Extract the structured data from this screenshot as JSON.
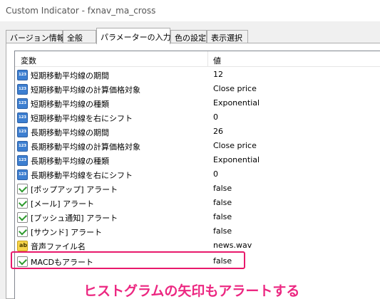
{
  "window": {
    "title": "Custom Indicator - fxnav_ma_cross"
  },
  "tabs": [
    {
      "label": "バージョン情報"
    },
    {
      "label": "全般"
    },
    {
      "label": "パラメーターの入力",
      "active": true
    },
    {
      "label": "色の設定"
    },
    {
      "label": "表示選択"
    }
  ],
  "grid": {
    "header_variable": "変数",
    "header_value": "値",
    "rows": [
      {
        "name": "短期移動平均線の期間",
        "value": "12",
        "icon": "number-icon"
      },
      {
        "name": "短期移動平均線の計算価格対象",
        "value": "Close price",
        "icon": "number-icon"
      },
      {
        "name": "短期移動平均線の種類",
        "value": "Exponential",
        "icon": "number-icon"
      },
      {
        "name": "短期移動平均線を右にシフト",
        "value": "0",
        "icon": "number-icon"
      },
      {
        "name": "長期移動平均線の期間",
        "value": "26",
        "icon": "number-icon"
      },
      {
        "name": "長期移動平均線の計算価格対象",
        "value": "Close price",
        "icon": "number-icon"
      },
      {
        "name": "長期移動平均線の種類",
        "value": "Exponential",
        "icon": "number-icon"
      },
      {
        "name": "長期移動平均線を右にシフト",
        "value": "0",
        "icon": "number-icon"
      },
      {
        "name": "[ポップアップ] アラート",
        "value": "false",
        "icon": "boolean-icon"
      },
      {
        "name": "[メール] アラート",
        "value": "false",
        "icon": "boolean-icon"
      },
      {
        "name": "[プッシュ通知] アラート",
        "value": "false",
        "icon": "boolean-icon"
      },
      {
        "name": "[サウンド] アラート",
        "value": "false",
        "icon": "boolean-icon"
      },
      {
        "name": "音声ファイル名",
        "value": "news.wav",
        "icon": "string-icon"
      },
      {
        "name": "MACDもアラート",
        "value": "false",
        "icon": "boolean-icon"
      }
    ]
  },
  "annotation": {
    "text": "ヒストグラムの矢印もアラートする",
    "color": "#ec2781"
  },
  "colors": {
    "highlight_border": "#e8196b"
  }
}
